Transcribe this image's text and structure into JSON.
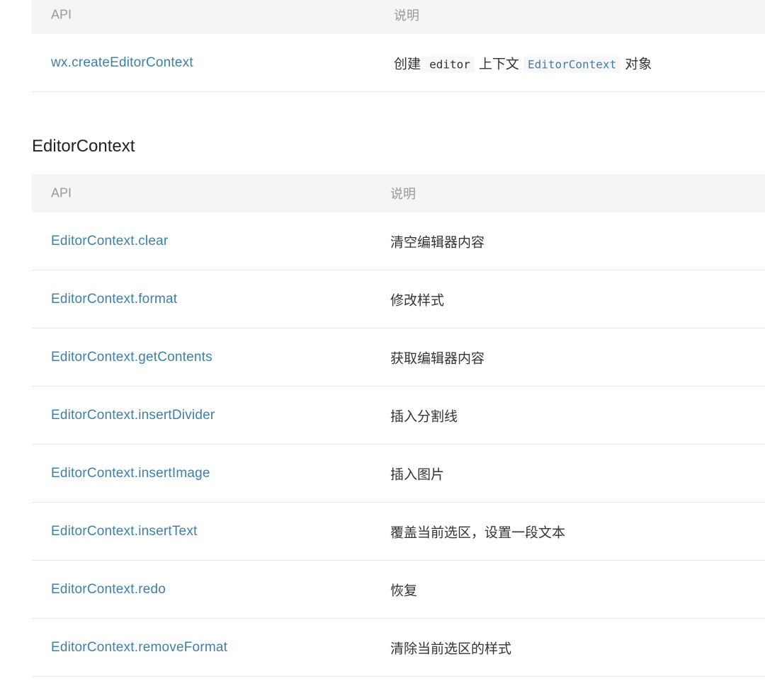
{
  "top_table": {
    "header": {
      "api": "API",
      "desc": "说明"
    },
    "row": {
      "api": "wx.createEditorContext",
      "desc_prefix": "创建",
      "code1": "editor",
      "desc_middle": "上下文",
      "code2": "EditorContext",
      "desc_suffix": "对象"
    }
  },
  "section": {
    "title": "EditorContext"
  },
  "editor_table": {
    "header": {
      "api": "API",
      "desc": "说明"
    },
    "rows": [
      {
        "api": "EditorContext.clear",
        "desc": "清空编辑器内容"
      },
      {
        "api": "EditorContext.format",
        "desc": "修改样式"
      },
      {
        "api": "EditorContext.getContents",
        "desc": "获取编辑器内容"
      },
      {
        "api": "EditorContext.insertDivider",
        "desc": "插入分割线"
      },
      {
        "api": "EditorContext.insertImage",
        "desc": "插入图片"
      },
      {
        "api": "EditorContext.insertText",
        "desc": "覆盖当前选区，设置一段文本"
      },
      {
        "api": "EditorContext.redo",
        "desc": "恢复"
      },
      {
        "api": "EditorContext.removeFormat",
        "desc": "清除当前选区的样式"
      }
    ]
  },
  "colors": {
    "link": "#3f7fa8",
    "header_bg": "#f5f5f5",
    "border": "#e6e6e6"
  }
}
